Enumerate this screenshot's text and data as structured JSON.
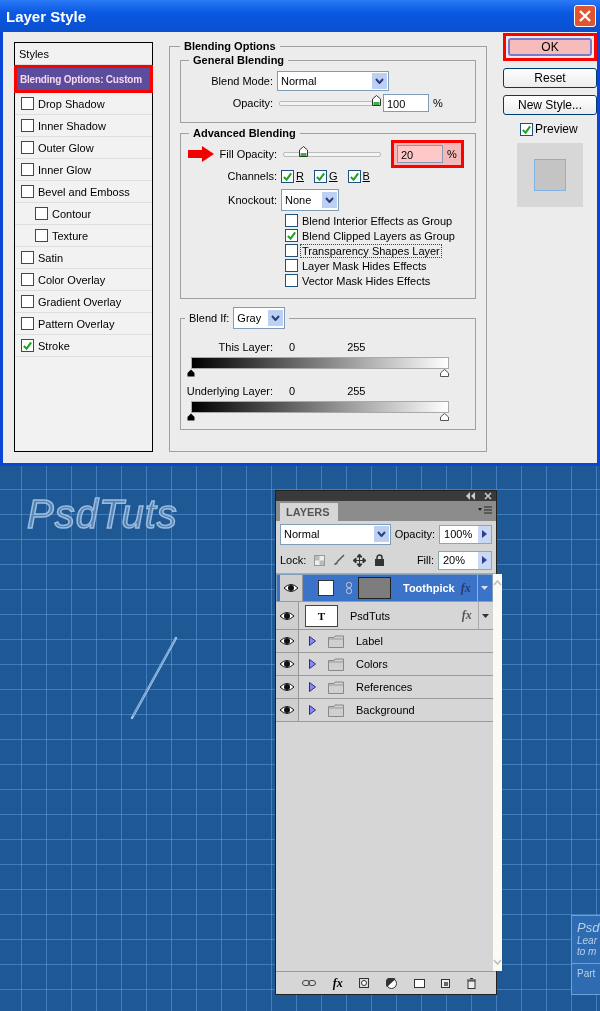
{
  "dialog": {
    "title": "Layer Style",
    "styles_list": [
      {
        "label": "Styles",
        "kind": "header"
      },
      {
        "label": "Blending Options: Custom",
        "kind": "option",
        "selected": true,
        "highlighted": true
      },
      {
        "label": "Drop Shadow",
        "kind": "effect",
        "checked": false,
        "selected": false
      },
      {
        "label": "Inner Shadow",
        "kind": "effect",
        "checked": false,
        "selected": false
      },
      {
        "label": "Outer Glow",
        "kind": "effect",
        "checked": false,
        "selected": false
      },
      {
        "label": "Inner Glow",
        "kind": "effect",
        "checked": false,
        "selected": false
      },
      {
        "label": "Bevel and Emboss",
        "kind": "effect",
        "checked": false,
        "selected": false,
        "children": [
          {
            "label": "Contour",
            "kind": "effect",
            "checked": false,
            "selected": false
          },
          {
            "label": "Texture",
            "kind": "effect",
            "checked": false,
            "selected": false
          }
        ]
      },
      {
        "label": "Satin",
        "kind": "effect",
        "checked": false,
        "selected": false
      },
      {
        "label": "Color Overlay",
        "kind": "effect",
        "checked": false,
        "selected": false
      },
      {
        "label": "Gradient Overlay",
        "kind": "effect",
        "checked": false,
        "selected": false
      },
      {
        "label": "Pattern Overlay",
        "kind": "effect",
        "checked": false,
        "selected": false
      },
      {
        "label": "Stroke",
        "kind": "effect",
        "checked": true,
        "selected": false
      }
    ],
    "blending_options": {
      "title": "Blending Options",
      "general": {
        "title": "General Blending",
        "blend_mode": {
          "label": "Blend Mode:",
          "value": "Normal"
        },
        "opacity": {
          "label": "Opacity:",
          "level": 1.0,
          "value": "100",
          "unit": "%"
        }
      },
      "advanced": {
        "title": "Advanced Blending",
        "fill_opacity": {
          "label": "Fill Opacity:",
          "level": 0.2,
          "value": "20",
          "unit": "%",
          "highlighted": true,
          "arrow": true
        },
        "channels": {
          "label": "Channels:",
          "items": [
            {
              "label": "R",
              "checked": true
            },
            {
              "label": "G",
              "checked": true
            },
            {
              "label": "B",
              "checked": true
            }
          ]
        },
        "knockout": {
          "label": "Knockout:",
          "value": "None"
        },
        "options": [
          {
            "label": "Blend Interior Effects as Group",
            "checked": false,
            "focused": false
          },
          {
            "label": "Blend Clipped Layers as Group",
            "checked": true,
            "focused": false
          },
          {
            "label": "Transparency Shapes Layer",
            "checked": false,
            "focused": true
          },
          {
            "label": "Layer Mask Hides Effects",
            "checked": false,
            "focused": false
          },
          {
            "label": "Vector Mask Hides Effects",
            "checked": false,
            "focused": false
          }
        ]
      },
      "blend_if": {
        "label": "Blend If:",
        "value": "Gray",
        "sliders": [
          {
            "label": "This Layer:",
            "low": "0",
            "high": "255"
          },
          {
            "label": "Underlying Layer:",
            "low": "0",
            "high": "255"
          }
        ]
      }
    },
    "buttons": [
      {
        "label": "OK",
        "default": true,
        "highlighted": true
      },
      {
        "label": "Reset",
        "default": false,
        "highlighted": false
      },
      {
        "label": "New Style...",
        "default": false,
        "highlighted": false
      }
    ],
    "preview": {
      "label": "Preview",
      "checked": true
    }
  },
  "canvas": {
    "logo": "PsdTuts",
    "layers_panel": {
      "tab": "LAYERS",
      "blend_mode": "Normal",
      "opacity_label": "Opacity:",
      "opacity": "100%",
      "lock_label": "Lock:",
      "fill_label": "Fill:",
      "fill": "20%",
      "layers": [
        {
          "name": "Toothpick",
          "kind": "shape",
          "visible": true,
          "selected": true,
          "fx": "fx"
        },
        {
          "name": "PsdTuts",
          "kind": "text",
          "thumb": "T",
          "visible": true,
          "selected": false,
          "fx": "fx"
        },
        {
          "name": "Label",
          "kind": "group",
          "visible": true,
          "selected": false
        },
        {
          "name": "Colors",
          "kind": "group",
          "visible": true,
          "selected": false
        },
        {
          "name": "References",
          "kind": "group",
          "visible": true,
          "selected": false
        },
        {
          "name": "Background",
          "kind": "group",
          "visible": true,
          "selected": false
        }
      ],
      "footer_fx": "fx"
    },
    "card": {
      "title": "Psd",
      "lines": [
        "Lear",
        "to m"
      ],
      "footer": "Part"
    }
  }
}
